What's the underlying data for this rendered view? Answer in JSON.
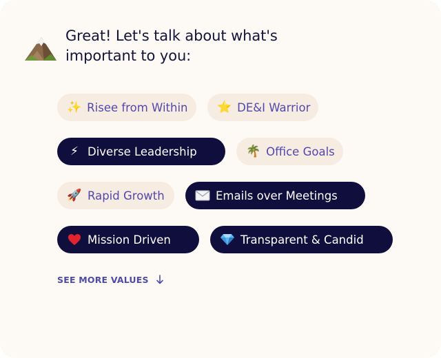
{
  "prompt": {
    "heading": "Great! Let's talk about what's important to you:",
    "icon": "mountain-icon"
  },
  "values": [
    {
      "icon_name": "sparkles-icon",
      "emoji": "✨",
      "label": "Risee from Within",
      "selected": false
    },
    {
      "icon_name": "star-icon",
      "emoji": "⭐",
      "label": "DE&I Warrior",
      "selected": false
    },
    {
      "icon_name": "lightning-icon",
      "emoji": "⚡",
      "label": "Diverse Leadership",
      "selected": true
    },
    {
      "icon_name": "palm-tree-icon",
      "emoji": "🌴",
      "label": "Office Goals",
      "selected": false
    },
    {
      "icon_name": "rocket-icon",
      "emoji": "🚀",
      "label": "Rapid Growth",
      "selected": false
    },
    {
      "icon_name": "envelope-icon",
      "emoji": "✉️",
      "label": "Emails over Meetings",
      "selected": true
    },
    {
      "icon_name": "heart-icon",
      "emoji": "❤️",
      "label": "Mission Driven",
      "selected": true
    },
    {
      "icon_name": "gem-icon",
      "emoji": "💎",
      "label": "Transparent & Candid",
      "selected": true
    }
  ],
  "see_more": {
    "label": "SEE MORE VALUES",
    "icon": "arrow-down-icon"
  },
  "colors": {
    "card_background": "#fdf9f4",
    "chip_unselected_bg": "#f6ece2",
    "chip_unselected_text": "#5148ad",
    "chip_selected_bg": "#100e3d",
    "chip_selected_text": "#ffffff",
    "heading_text": "#14143a",
    "link_text": "#4c4ba8"
  }
}
